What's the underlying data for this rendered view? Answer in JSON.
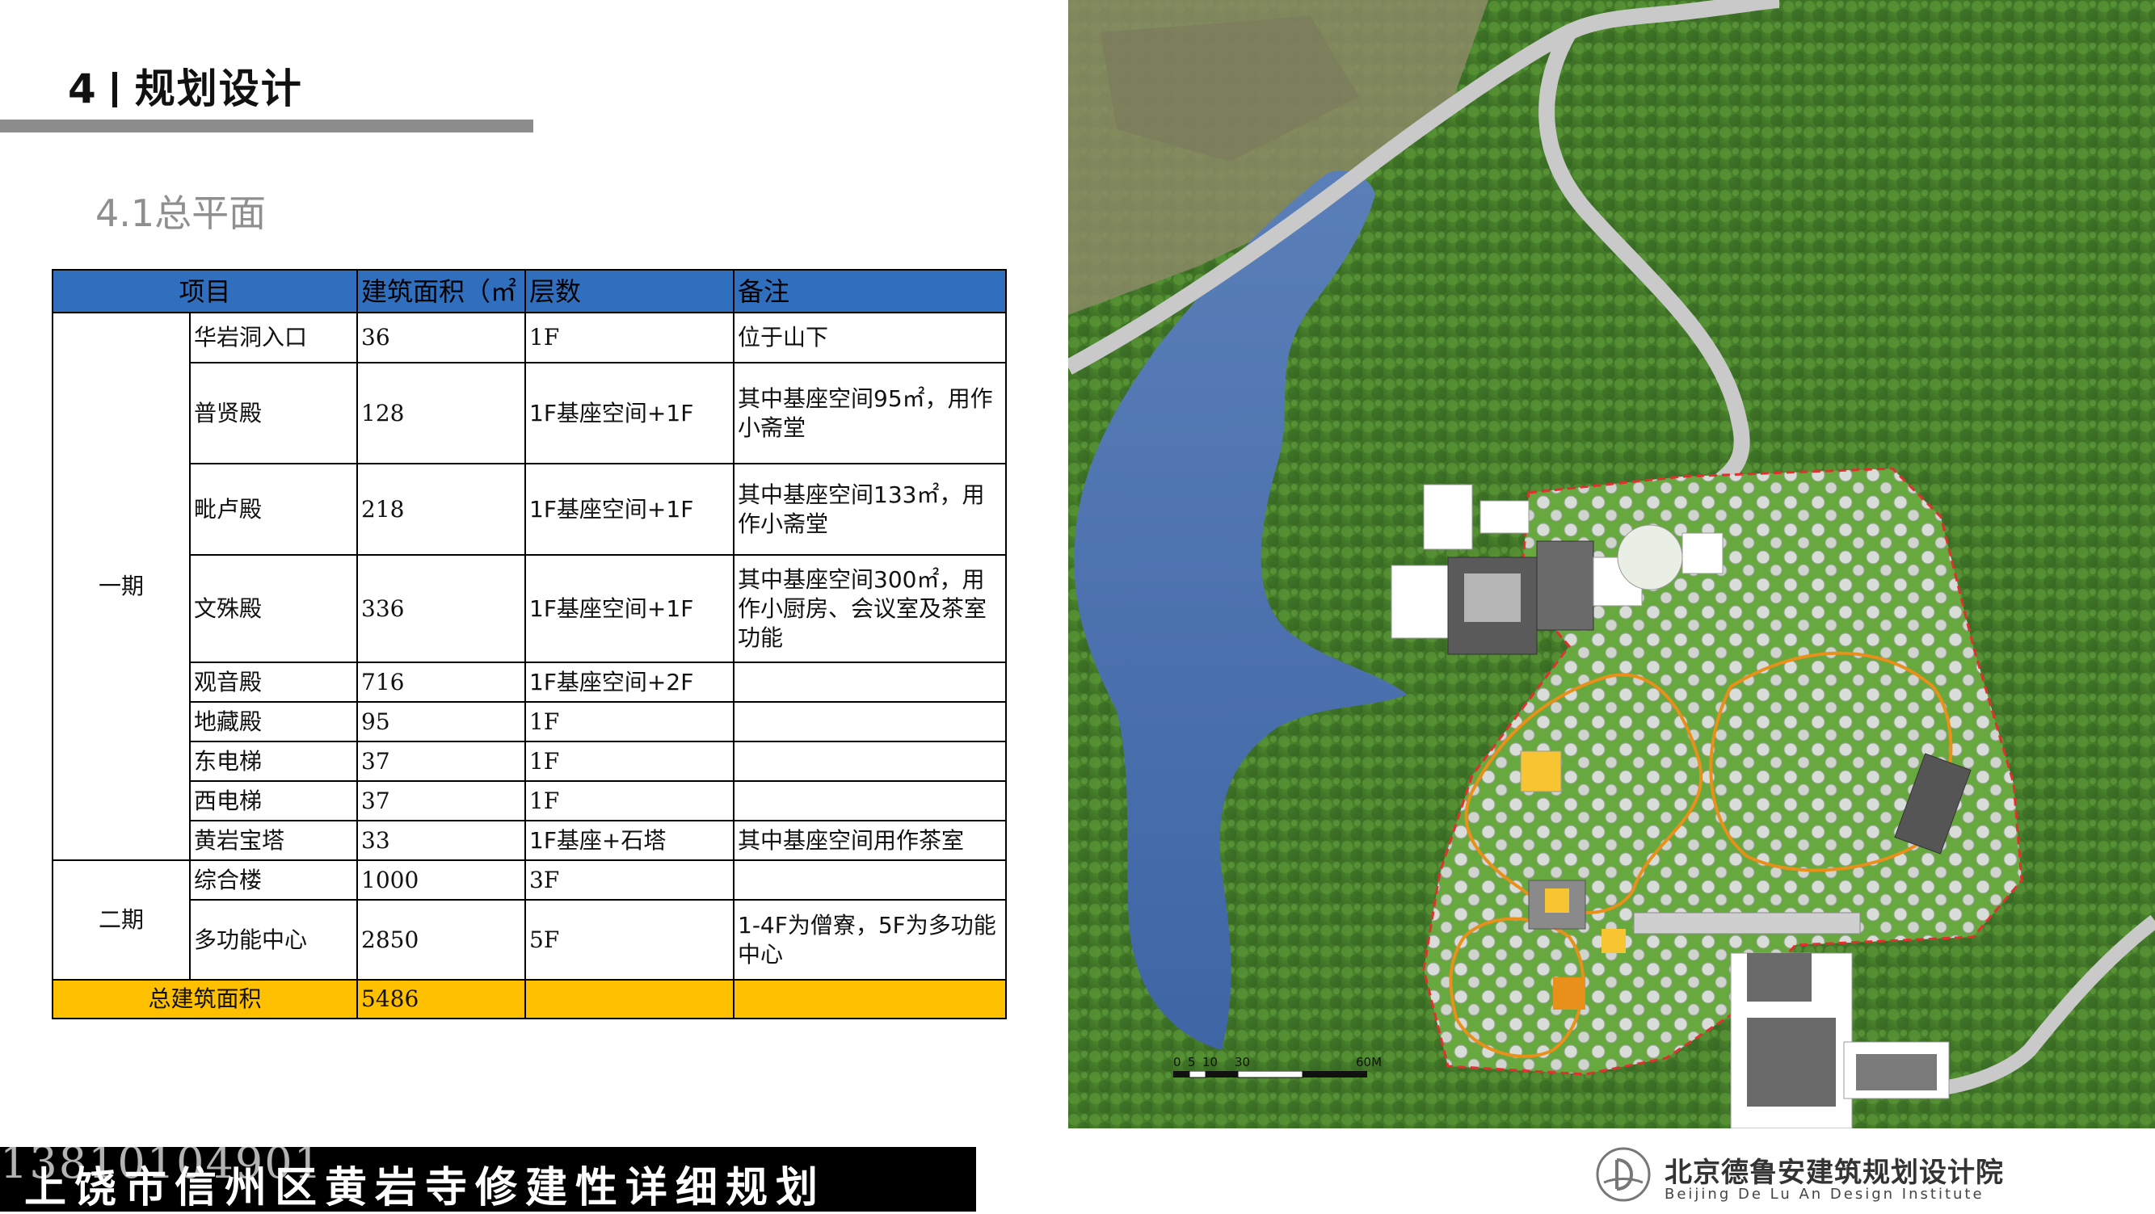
{
  "header": {
    "section_number": "4",
    "section_title": "规划设计",
    "subtitle": "4.1总平面"
  },
  "table": {
    "headers": [
      "项目",
      "建筑面积（㎡",
      "层数",
      "备注"
    ],
    "phase1_label": "一期",
    "phase2_label": "二期",
    "phase1_rows": [
      {
        "name": "华岩洞入口",
        "area": "36",
        "floors": "1F",
        "note": "位于山下"
      },
      {
        "name": "普贤殿",
        "area": "128",
        "floors": "1F基座空间+1F",
        "note": "其中基座空间95㎡，用作小斋堂"
      },
      {
        "name": "毗卢殿",
        "area": "218",
        "floors": "1F基座空间+1F",
        "note": "其中基座空间133㎡，用作小斋堂"
      },
      {
        "name": "文殊殿",
        "area": "336",
        "floors": "1F基座空间+1F",
        "note": "其中基座空间300㎡，用作小厨房、会议室及茶室功能"
      },
      {
        "name": "观音殿",
        "area": "716",
        "floors": "1F基座空间+2F",
        "note": ""
      },
      {
        "name": "地藏殿",
        "area": "95",
        "floors": "1F",
        "note": ""
      },
      {
        "name": "东电梯",
        "area": "37",
        "floors": "1F",
        "note": ""
      },
      {
        "name": "西电梯",
        "area": "37",
        "floors": "1F",
        "note": ""
      },
      {
        "name": "黄岩宝塔",
        "area": "33",
        "floors": "1F基座+石塔",
        "note": "其中基座空间用作茶室"
      }
    ],
    "phase2_rows": [
      {
        "name": "综合楼",
        "area": "1000",
        "floors": "3F",
        "note": ""
      },
      {
        "name": "多功能中心",
        "area": "2850",
        "floors": "5F",
        "note": "1-4F为僧寮，5F为多功能中心"
      }
    ],
    "total": {
      "label": "总建筑面积",
      "area": "5486"
    }
  },
  "footer": {
    "title": "上饶市信州区黄岩寺修建性详细规划",
    "watermark": "13810104901"
  },
  "map": {
    "scale_labels": [
      "0",
      "5",
      "10",
      "30",
      "60M"
    ]
  },
  "logo": {
    "name_cn": "北京德鲁安建筑规划设计院",
    "name_en": "Beijing De Lu An Design Institute"
  },
  "colors": {
    "header_blue": "#2f6fbd",
    "total_yellow": "#ffc000",
    "rule_gray": "#8c8c8c",
    "site_boundary": "#e03030",
    "path_orange": "#e8901a"
  }
}
